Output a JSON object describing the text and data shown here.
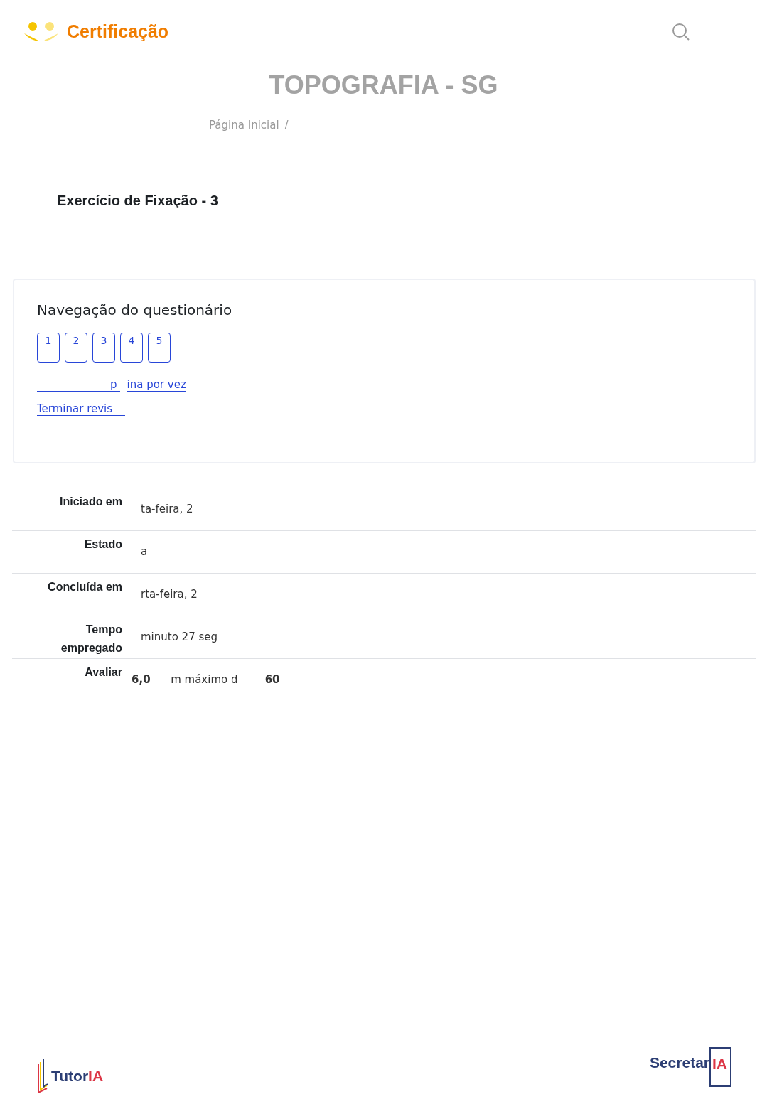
{
  "header": {
    "brand": "Certificação"
  },
  "page_title": "TOPOGRAFIA - SG",
  "breadcrumb": [
    {
      "text": "Página Inicial",
      "separator": "/"
    }
  ],
  "activity_title": "Exercício de Fixação - 3",
  "quiz_nav": {
    "title": "Navegação do questionário",
    "questions": [
      "1",
      "2",
      "3",
      "4",
      "5"
    ],
    "links": [
      {
        "kind": "lead",
        "text": "p"
      },
      {
        "kind": "plain",
        "text": "ina por vez"
      },
      {
        "kind": "trail",
        "text": "Terminar revis"
      }
    ]
  },
  "summary": [
    {
      "label": "Iniciado em",
      "value": "ta-feira, 2"
    },
    {
      "label": "Estado",
      "value": "a"
    },
    {
      "label": "Concluída em",
      "value": "rta-feira, 2"
    },
    {
      "label": "Tempo empregado",
      "value": "minuto 27 seg"
    },
    {
      "label": "Avaliar",
      "value": "**6,0**      m máximo d        **60**"
    }
  ],
  "footer": {
    "left": {
      "name": "Tutor",
      "accent": "IA"
    },
    "right": {
      "name": "Secretar",
      "accent": "IA"
    }
  }
}
